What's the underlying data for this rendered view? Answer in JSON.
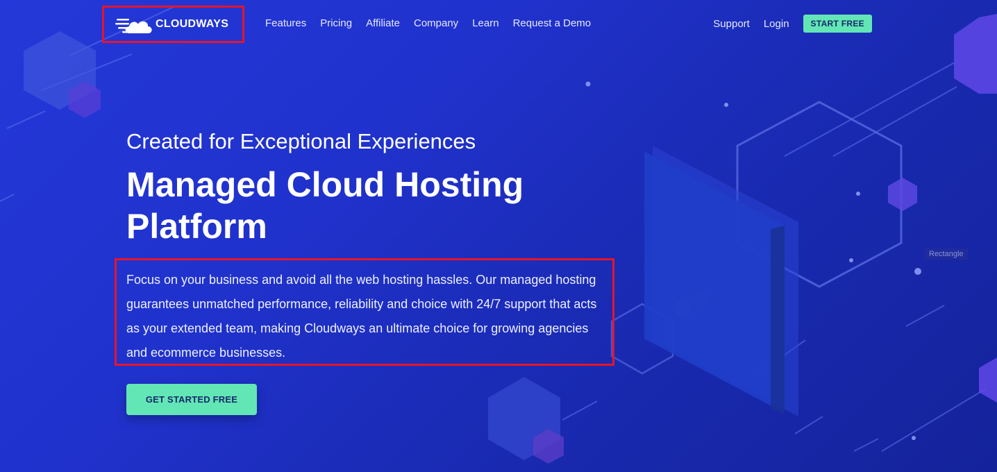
{
  "nav": {
    "logo_text": "CLOUDWAYS",
    "links": [
      "Features",
      "Pricing",
      "Affiliate",
      "Company",
      "Learn",
      "Request a Demo"
    ],
    "support": "Support",
    "login": "Login",
    "start_free": "START FREE"
  },
  "hero": {
    "subtitle": "Created for Exceptional Experiences",
    "title": "Managed Cloud Hosting Platform",
    "description": "Focus on your business and avoid all the web hosting hassles. Our managed hosting guarantees unmatched performance, reliability and choice with 24/7 support that acts as your extended team, making Cloudways an ultimate choice for growing agencies and ecommerce businesses.",
    "cta": "GET STARTED FREE"
  },
  "decor": {
    "rectangle_label": "Rectangle"
  },
  "colors": {
    "accent_green": "#63e6b5",
    "highlight_red": "#e8142a",
    "background_blue": "#2438d9"
  }
}
